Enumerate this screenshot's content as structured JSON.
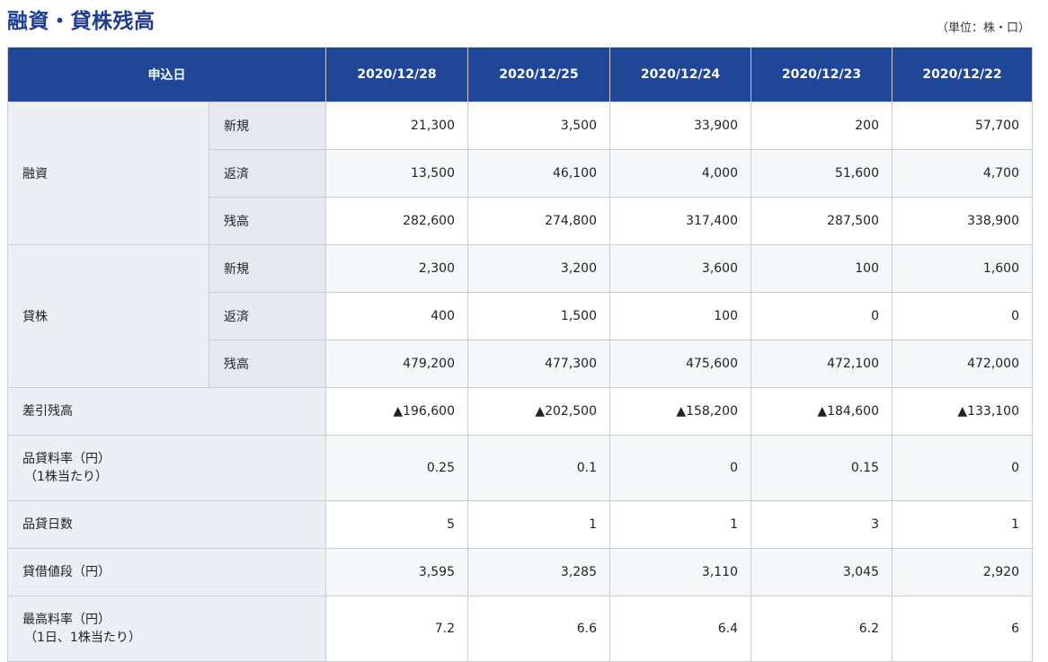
{
  "title": "融資・貸株残高",
  "unit": "（単位：株・口）",
  "header": {
    "label": "申込日",
    "dates": [
      "2020/12/28",
      "2020/12/25",
      "2020/12/24",
      "2020/12/23",
      "2020/12/22"
    ]
  },
  "margin": {
    "label": "融資",
    "rows": [
      {
        "label": "新規",
        "values": [
          "21,300",
          "3,500",
          "33,900",
          "200",
          "57,700"
        ]
      },
      {
        "label": "返済",
        "values": [
          "13,500",
          "46,100",
          "4,000",
          "51,600",
          "4,700"
        ]
      },
      {
        "label": "残高",
        "values": [
          "282,600",
          "274,800",
          "317,400",
          "287,500",
          "338,900"
        ]
      }
    ]
  },
  "lending": {
    "label": "貸株",
    "rows": [
      {
        "label": "新規",
        "values": [
          "2,300",
          "3,200",
          "3,600",
          "100",
          "1,600"
        ]
      },
      {
        "label": "返済",
        "values": [
          "400",
          "1,500",
          "100",
          "0",
          "0"
        ]
      },
      {
        "label": "残高",
        "values": [
          "479,200",
          "477,300",
          "475,600",
          "472,100",
          "472,000"
        ]
      }
    ]
  },
  "summary": [
    {
      "label": "差引残高",
      "label2": "",
      "values": [
        "▲196,600",
        "▲202,500",
        "▲158,200",
        "▲184,600",
        "▲133,100"
      ]
    },
    {
      "label": "品貸料率（円）",
      "label2": "（1株当たり）",
      "values": [
        "0.25",
        "0.1",
        "0",
        "0.15",
        "0"
      ]
    },
    {
      "label": "品貸日数",
      "label2": "",
      "values": [
        "5",
        "1",
        "1",
        "3",
        "1"
      ]
    },
    {
      "label": "貸借値段（円）",
      "label2": "",
      "values": [
        "3,595",
        "3,285",
        "3,110",
        "3,045",
        "2,920"
      ]
    },
    {
      "label": "最高料率（円）",
      "label2": "（1日、1株当たり）",
      "values": [
        "7.2",
        "6.6",
        "6.4",
        "6.2",
        "6"
      ]
    }
  ]
}
